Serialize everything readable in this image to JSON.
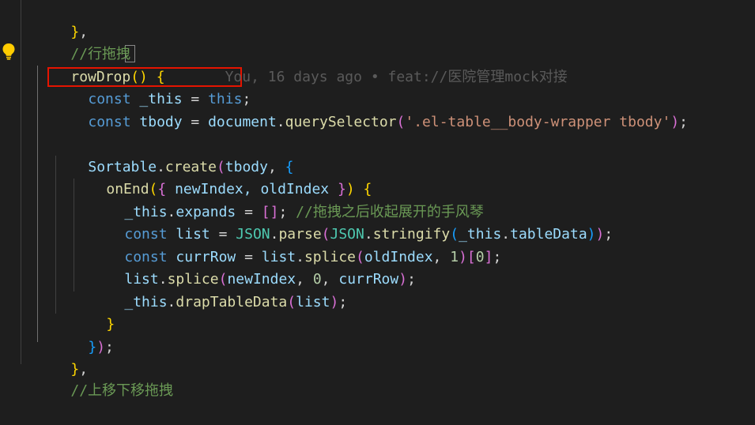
{
  "code": {
    "line1": {
      "close": "}",
      "comma": ","
    },
    "line2": {
      "comment": "//行拖拽"
    },
    "line3": {
      "fn": "rowDrop",
      "parens": "()",
      "sp": " ",
      "brace": "{",
      "blame": "You, 16 days ago • feat://医院管理mock对接"
    },
    "line4": {
      "kw": "const",
      "var": "_this",
      "eq": " = ",
      "this": "this",
      "semi": ";"
    },
    "line5": {
      "kw": "const",
      "var": "tbody",
      "eq": " = ",
      "obj": "document",
      "dot": ".",
      "method": "querySelector",
      "open": "(",
      "str": "'.el-table__body-wrapper tbody'",
      "close": ")",
      "semi": ";"
    },
    "line7": {
      "cls": "Sortable",
      "dot": ".",
      "method": "create",
      "open": "(",
      "arg": "tbody",
      "comma": ", ",
      "brace": "{"
    },
    "line8": {
      "fn": "onEnd",
      "open": "(",
      "brace1": "{",
      "params": " newIndex, oldIndex ",
      "brace2": "}",
      "close": ")",
      "sp": " ",
      "brace3": "{"
    },
    "line9": {
      "var": "_this",
      "dot": ".",
      "prop": "expands",
      "eq": " = ",
      "arr": "[]",
      "semi": ";",
      "sp": " ",
      "comment": "//拖拽之后收起展开的手风琴"
    },
    "line10": {
      "kw": "const",
      "var": "list",
      "eq": " = ",
      "cls1": "JSON",
      "dot1": ".",
      "m1": "parse",
      "open1": "(",
      "cls2": "JSON",
      "dot2": ".",
      "m2": "stringify",
      "open2": "(",
      "arg": "_this",
      "dot3": ".",
      "prop": "tableData",
      "close2": ")",
      "close1": ")",
      "semi": ";"
    },
    "line11": {
      "kw": "const",
      "var": "currRow",
      "eq": " = ",
      "obj": "list",
      "dot": ".",
      "m": "splice",
      "open": "(",
      "arg": "oldIndex",
      "comma": ", ",
      "num": "1",
      "close": ")",
      "bo": "[",
      "idx": "0",
      "bc": "]",
      "semi": ";"
    },
    "line12": {
      "obj": "list",
      "dot": ".",
      "m": "splice",
      "open": "(",
      "a1": "newIndex",
      "c1": ", ",
      "a2": "0",
      "c2": ", ",
      "a3": "currRow",
      "close": ")",
      "semi": ";"
    },
    "line13": {
      "var": "_this",
      "dot": ".",
      "m": "drapTableData",
      "open": "(",
      "arg": "list",
      "close": ")",
      "semi": ";"
    },
    "line14": {
      "brace": "}"
    },
    "line15": {
      "brace": "}",
      "close": ")",
      "semi": ";"
    },
    "line16": {
      "brace": "}",
      "comma": ","
    },
    "line17": {
      "comment": "//上移下移拖拽"
    }
  },
  "colors": {
    "background": "#1e1e1e",
    "keyword": "#569cd6",
    "function": "#dcdcaa",
    "variable": "#9cdcfe",
    "string": "#ce9178",
    "number": "#b5cea8",
    "comment": "#6a9955",
    "class": "#4ec9b0",
    "highlight_box": "#e51400"
  },
  "icons": {
    "bulb": "lightbulb-icon"
  }
}
